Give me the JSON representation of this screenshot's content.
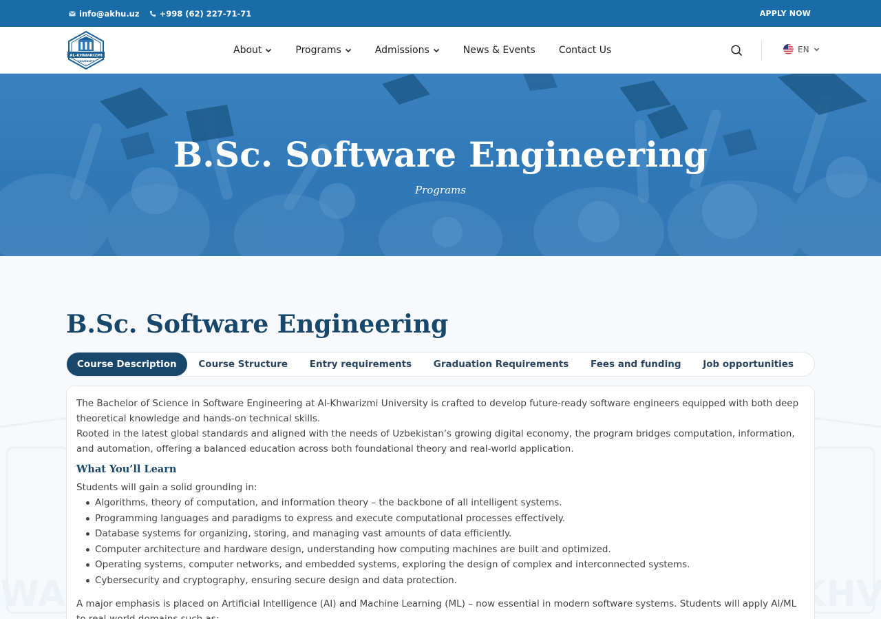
{
  "topbar": {
    "email": "info@akhu.uz",
    "phone": "+998 (62) 227-71-71",
    "apply_label": "APPLY NOW"
  },
  "header": {
    "logo_name": "AL-KHWARIZMI",
    "logo_sub": "UNIVERSITY",
    "nav": [
      {
        "label": "About",
        "has_dropdown": true
      },
      {
        "label": "Programs",
        "has_dropdown": true
      },
      {
        "label": "Admissions",
        "has_dropdown": true
      },
      {
        "label": "News & Events",
        "has_dropdown": false
      },
      {
        "label": "Contact Us",
        "has_dropdown": false
      }
    ],
    "search_icon": "search-icon",
    "language": "EN"
  },
  "hero": {
    "title": "B.Sc. Software Engineering",
    "subtitle": "Programs"
  },
  "main": {
    "title": "B.Sc. Software Engineering",
    "tabs": [
      {
        "label": "Course Description",
        "active": true
      },
      {
        "label": "Course Structure",
        "active": false
      },
      {
        "label": "Entry requirements",
        "active": false
      },
      {
        "label": "Graduation Requirements",
        "active": false
      },
      {
        "label": "Fees and funding",
        "active": false
      },
      {
        "label": "Job opportunities",
        "active": false
      }
    ],
    "content": {
      "intro1": "The Bachelor of Science in Software Engineering at Al-Khwarizmi University is crafted to develop future-ready software engineers equipped with both deep theoretical knowledge and hands-on technical skills.",
      "intro2": "Rooted in the latest global standards and aligned with the needs of Uzbekistan’s growing digital economy, the program bridges computation, information, and automation, offering a balanced education across both foundational theory and real-world application.",
      "learn_heading": "What You’ll Learn",
      "learn_lead": "Students will gain a solid grounding in:",
      "learn_items": [
        "Algorithms, theory of computation, and information theory – the backbone of all intelligent systems.",
        "Programming languages and paradigms to express and execute computational processes effectively.",
        "Database systems for organizing, storing, and managing vast amounts of data efficiently.",
        "Computer architecture and hardware design, understanding how computing machines are built and optimized.",
        "Operating systems, computer networks, and embedded systems, exploring the design of complex and interconnected systems.",
        "Cybersecurity and cryptography, ensuring secure design and data protection."
      ],
      "emphasis": "A major emphasis is placed on Artificial Intelligence (AI) and Machine Learning (ML) – now essential in modern software systems. Students will apply AI/ML to real-world domains such as:"
    }
  },
  "colors": {
    "topbar": "#1a6ca8",
    "hero": "#2f78b8",
    "title": "#17476b",
    "active_tab": "#17476b"
  }
}
